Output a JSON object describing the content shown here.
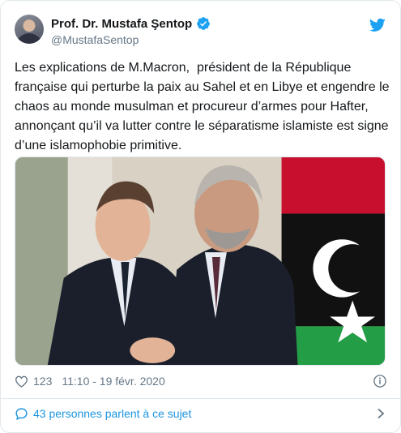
{
  "author": {
    "display_name": "Prof. Dr. Mustafa Şentop",
    "handle": "@MustafaSentop",
    "verified_icon": "verified-badge-icon",
    "avatar_icon": "avatar"
  },
  "tweet": {
    "text": "Les explications de M.Macron,  président de la République française qui perturbe la paix au Sahel et en Libye et engendre le chaos au monde musulman et procureur d’armes pour Hafter, annonçant qu’il va lutter contre le séparatisme islamiste est signe d’une islamophobie primitive.",
    "media_icon": "photo"
  },
  "meta": {
    "likes": "123",
    "timestamp": "11:10 - 19 févr. 2020"
  },
  "conversation": {
    "label": "43 personnes parlent à ce sujet"
  },
  "colors": {
    "twitter_blue": "#1da1f2",
    "link_blue": "#1b95e0",
    "text": "#14171a",
    "secondary": "#657786",
    "border": "#e1e8ed"
  }
}
